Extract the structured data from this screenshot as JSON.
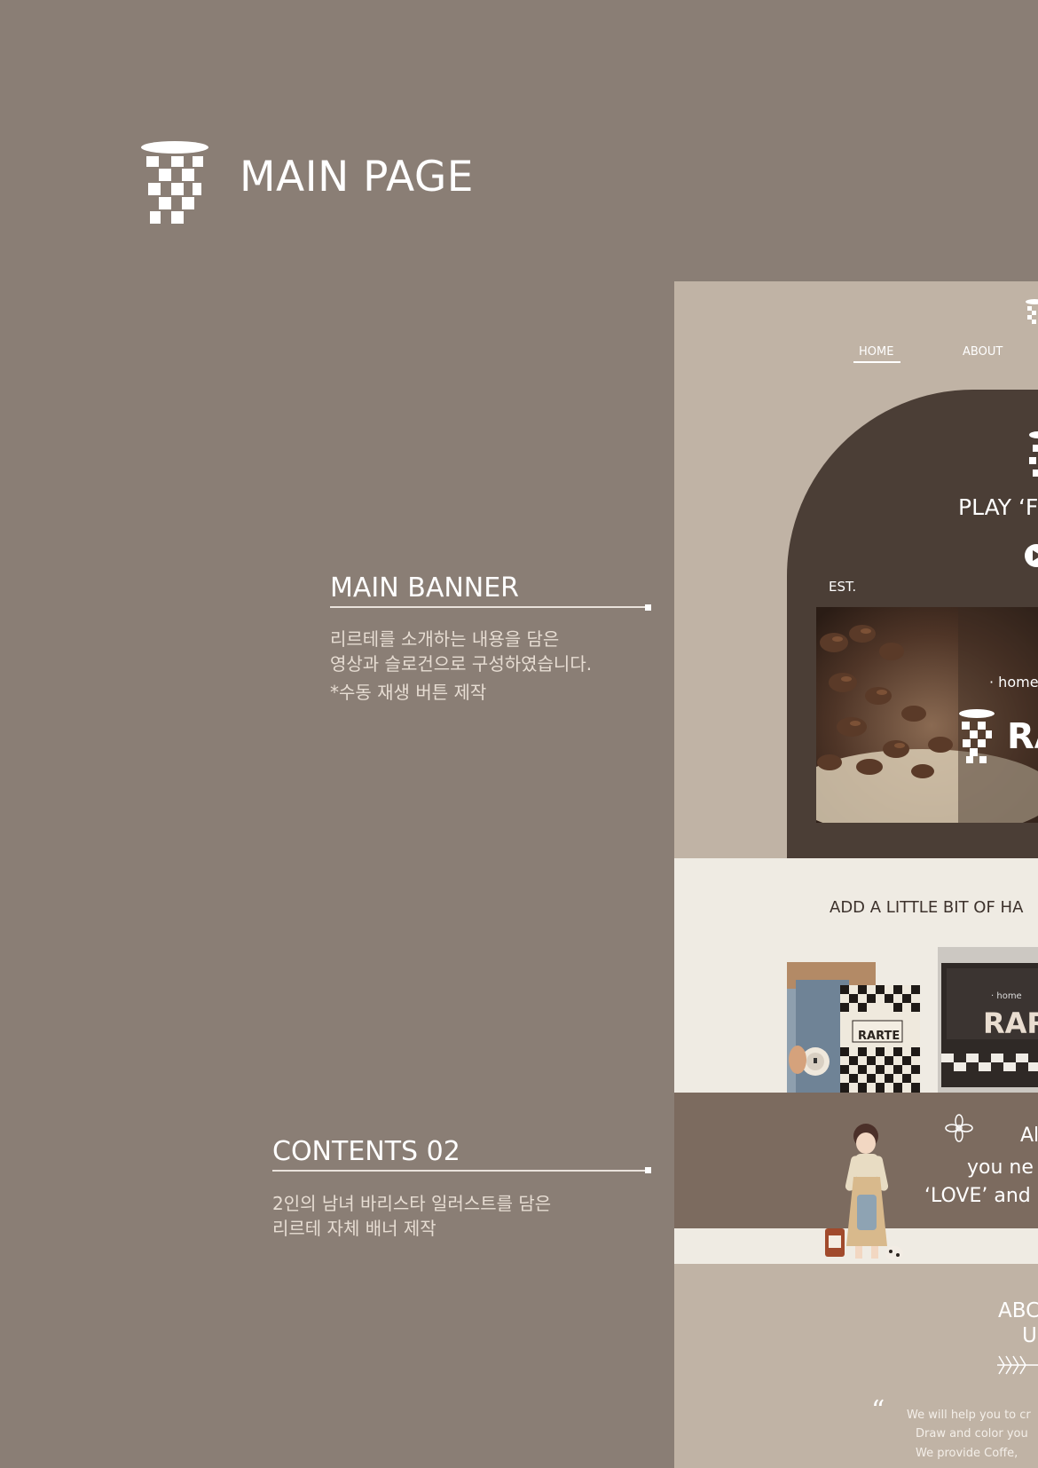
{
  "header": {
    "title": "MAIN PAGE"
  },
  "annotations": {
    "main_banner": {
      "title": "MAIN BANNER",
      "lines": [
        "리르테를 소개하는 내용을 담은",
        "영상과 슬로건으로 구성하였습니다.",
        "*수동 재생 버튼 제작"
      ]
    },
    "contents_02": {
      "title": "CONTENTS 02",
      "lines": [
        "2인의 남녀 바리스타 일러스트를 담은",
        "리르테 자체 배너 제작"
      ]
    }
  },
  "mockup": {
    "nav": {
      "home": "HOME",
      "about": "ABOUT"
    },
    "banner": {
      "play_text": "PLAY ‘F",
      "est": "EST.",
      "photo_home": "· home",
      "photo_brand": "RA"
    },
    "section2": {
      "heading": "ADD A LITTLE BIT OF HA",
      "brand_b": "RARTE",
      "home_c": "· home",
      "brand_c": "RAR"
    },
    "section3": {
      "line1": "Al",
      "line2": "you ne",
      "line3": "‘LOVE’ and"
    },
    "about": {
      "line1": "ABC",
      "line2": "U",
      "quote_mark": "“",
      "q1": "We will help you to cr",
      "q2": "Draw and color you",
      "q3": "We provide Coffe,"
    }
  },
  "colors": {
    "background": "#8a7e75",
    "mock_beige": "#c0b3a5",
    "mock_dark": "#4b3e36",
    "mock_cream": "#efebe3",
    "mock_brown": "#7c6b5f"
  }
}
